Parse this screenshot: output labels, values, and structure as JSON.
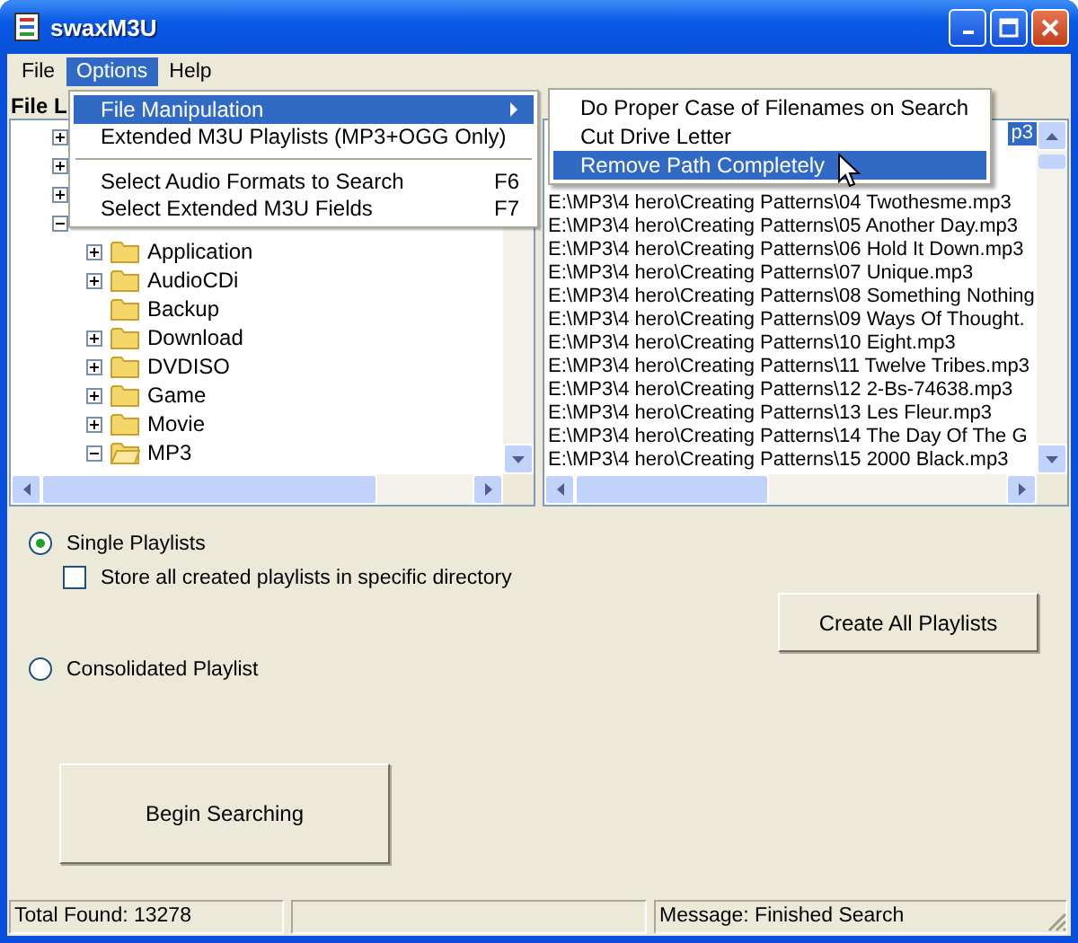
{
  "window": {
    "title": "swaxM3U"
  },
  "menu_bar": [
    {
      "label": "File",
      "selected": false
    },
    {
      "label": "Options",
      "selected": true
    },
    {
      "label": "Help",
      "selected": false
    }
  ],
  "options_menu": [
    {
      "kind": "item",
      "label": "File Manipulation",
      "submenu": true,
      "selected": true
    },
    {
      "kind": "item",
      "label": "Extended M3U Playlists (MP3+OGG Only)",
      "selected": false
    },
    {
      "kind": "separator"
    },
    {
      "kind": "item",
      "label": "Select Audio Formats to Search",
      "shortcut": "F6",
      "selected": false
    },
    {
      "kind": "item",
      "label": "Select Extended M3U Fields",
      "shortcut": "F7",
      "selected": false
    }
  ],
  "file_manipulation_menu": [
    {
      "label": "Do Proper Case of Filenames on Search",
      "selected": false
    },
    {
      "label": "Cut Drive Letter",
      "selected": false
    },
    {
      "label": "Remove Path Completely",
      "selected": true
    }
  ],
  "left_pane": {
    "header": "File L",
    "hidden_nodes": [
      {
        "expanded": false
      },
      {
        "expanded": false
      },
      {
        "expanded": false
      },
      {
        "expanded": true
      }
    ],
    "folders": [
      {
        "name": "Application",
        "expanded": false
      },
      {
        "name": "AudioCDi",
        "expanded": false
      },
      {
        "name": "Backup"
      },
      {
        "name": "Download",
        "expanded": false
      },
      {
        "name": "DVDISO",
        "expanded": false
      },
      {
        "name": "Game",
        "expanded": false
      },
      {
        "name": "Movie",
        "expanded": false
      },
      {
        "name": "MP3",
        "expanded": true
      }
    ]
  },
  "file_list": {
    "top_row": {
      "text": "p3",
      "selected": true
    },
    "rows": [
      {
        "text": "E:\\MP3\\4 hero\\Creating Patterns\\04 Twothesme.mp3",
        "selected": false
      },
      {
        "text": "E:\\MP3\\4 hero\\Creating Patterns\\05 Another Day.mp3",
        "selected": false
      },
      {
        "text": "E:\\MP3\\4 hero\\Creating Patterns\\06 Hold It Down.mp3",
        "selected": false
      },
      {
        "text": "E:\\MP3\\4 hero\\Creating Patterns\\07 Unique.mp3",
        "selected": false
      },
      {
        "text": "E:\\MP3\\4 hero\\Creating Patterns\\08 Something Nothing",
        "selected": false
      },
      {
        "text": "E:\\MP3\\4 hero\\Creating Patterns\\09 Ways Of Thought.",
        "selected": false
      },
      {
        "text": "E:\\MP3\\4 hero\\Creating Patterns\\10 Eight.mp3",
        "selected": false
      },
      {
        "text": "E:\\MP3\\4 hero\\Creating Patterns\\11 Twelve Tribes.mp3",
        "selected": false
      },
      {
        "text": "E:\\MP3\\4 hero\\Creating Patterns\\12 2-Bs-74638.mp3",
        "selected": false
      },
      {
        "text": "E:\\MP3\\4 hero\\Creating Patterns\\13 Les Fleur.mp3",
        "selected": false
      },
      {
        "text": "E:\\MP3\\4 hero\\Creating Patterns\\14 The Day Of The G",
        "selected": false
      },
      {
        "text": "E:\\MP3\\4 hero\\Creating Patterns\\15 2000 Black.mp3",
        "selected": false
      }
    ]
  },
  "options": {
    "single_playlists": {
      "label": "Single Playlists",
      "selected": true
    },
    "store_directory": {
      "label": "Store all created playlists in specific directory",
      "checked": false
    },
    "consolidated_playlist": {
      "label": "Consolidated Playlist",
      "selected": false
    },
    "create_button": "Create All Playlists",
    "begin_button": "Begin Searching"
  },
  "status_bar": {
    "total": "Total  Found: 13278",
    "message": "Message: Finished Search"
  }
}
